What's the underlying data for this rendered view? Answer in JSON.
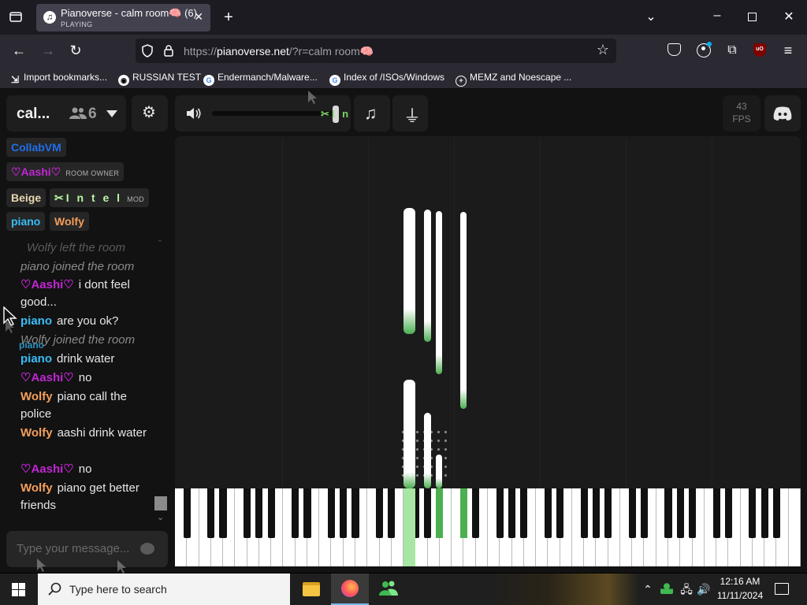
{
  "browser": {
    "tab": {
      "title": "Pianoverse - calm room🧠 (6)",
      "status": "PLAYING",
      "favicon": "♫"
    },
    "url": {
      "prefix": "https://",
      "host": "pianoverse.net",
      "path": "/?r=calm room🧠"
    },
    "bookmarks": [
      {
        "label": "Import bookmarks...",
        "icon": "import-icon"
      },
      {
        "label": "RUSSIAN TEST",
        "icon": "github-icon"
      },
      {
        "label": "Endermanch/Malware...",
        "icon": "google-icon"
      },
      {
        "label": "Index of /ISOs/Windows",
        "icon": "google-icon"
      },
      {
        "label": "MEMZ and Noescape ...",
        "icon": "globe-icon"
      }
    ]
  },
  "room": {
    "name": "cal...",
    "user_count": "6",
    "fps_value": "43",
    "fps_label": "FPS",
    "volume_owner": "✂I n t e l"
  },
  "users": [
    {
      "name": "CollabVM",
      "color": "#1f6feb",
      "badge": ""
    },
    {
      "name": "♡Aashi♡",
      "color": "#c026d3",
      "badge": "ROOM OWNER"
    },
    {
      "name": "Beige",
      "color": "#e8d7b0",
      "badge": ""
    },
    {
      "name": "✂I n t e l",
      "color": "#b9f5a4",
      "badge": "MOD"
    },
    {
      "name": "piano",
      "color": "#38bdf8",
      "badge": ""
    },
    {
      "name": "Wolfy",
      "color": "#f59e5b",
      "badge": ""
    }
  ],
  "chat": {
    "messages": [
      {
        "type": "system",
        "text": "Wolfy left the room"
      },
      {
        "type": "system",
        "text": "piano joined the room"
      },
      {
        "type": "msg",
        "name": "♡Aashi♡",
        "color": "#c026d3",
        "text": "i dont feel good..."
      },
      {
        "type": "msg",
        "name": "piano",
        "color": "#38bdf8",
        "text": "are you ok?"
      },
      {
        "type": "system",
        "text": "Wolfy joined the room"
      },
      {
        "type": "msg",
        "name": "piano",
        "color": "#38bdf8",
        "text": "drink water"
      },
      {
        "type": "msg",
        "name": "♡Aashi♡",
        "color": "#c026d3",
        "text": "no"
      },
      {
        "type": "msg",
        "name": "Wolfy",
        "color": "#f59e5b",
        "text": "piano call the police"
      },
      {
        "type": "msg",
        "name": "Wolfy",
        "color": "#f59e5b",
        "text": "aashi drink water"
      },
      {
        "type": "msg",
        "name": "♡Aashi♡",
        "color": "#c026d3",
        "text": "no"
      },
      {
        "type": "msg",
        "name": "Wolfy",
        "color": "#f59e5b",
        "text": "piano get better friends"
      }
    ],
    "placeholder": "Type your message...",
    "cursor_label": "piano"
  },
  "taskbar": {
    "search_placeholder": "Type here to search",
    "time": "12:16 AM",
    "date": "11/11/2024"
  },
  "colors": {
    "accent_green": "#4caf50",
    "page_bg": "#121212"
  }
}
